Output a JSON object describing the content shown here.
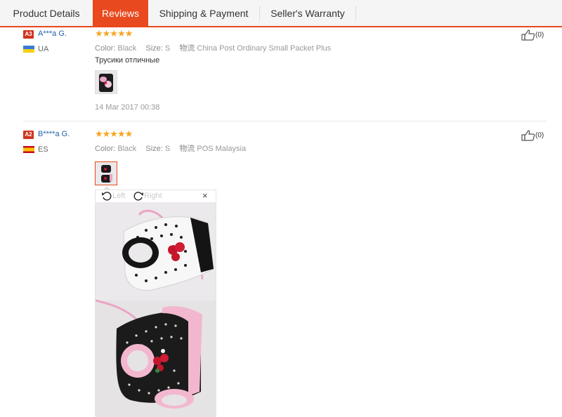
{
  "tabs": [
    {
      "label": "Product Details"
    },
    {
      "label": "Reviews"
    },
    {
      "label": "Shipping & Payment"
    },
    {
      "label": "Seller's Warranty"
    }
  ],
  "reviews": [
    {
      "level": "A3",
      "name": "A***a G.",
      "country": "UA",
      "stars": "★★★★★",
      "color_label": "Color:",
      "color_value": "Black",
      "size_label": "Size:",
      "size_value": "S",
      "logistics_label": "物流",
      "logistics_value": "China Post Ordinary Small Packet Plus",
      "text": "Трусики отличные",
      "date": "14 Mar 2017 00:38",
      "helpful": "(0)"
    },
    {
      "level": "A2",
      "name": "B****a G.",
      "country": "ES",
      "stars": "★★★★★",
      "color_label": "Color:",
      "color_value": "Black",
      "size_label": "Size:",
      "size_value": "S",
      "logistics_label": "物流",
      "logistics_value": "POS Malaysia",
      "helpful": "(0)"
    }
  ],
  "viewer": {
    "left_label": "Left",
    "right_label": "Right",
    "close_glyph": "×"
  },
  "colors": {
    "accent": "#e8491e",
    "link": "#1f5fa9",
    "star": "#f5a623",
    "badge": "#d0331e"
  },
  "icons": [
    "thumbs-up-icon",
    "rotate-left-icon",
    "rotate-right-icon",
    "close-icon"
  ]
}
